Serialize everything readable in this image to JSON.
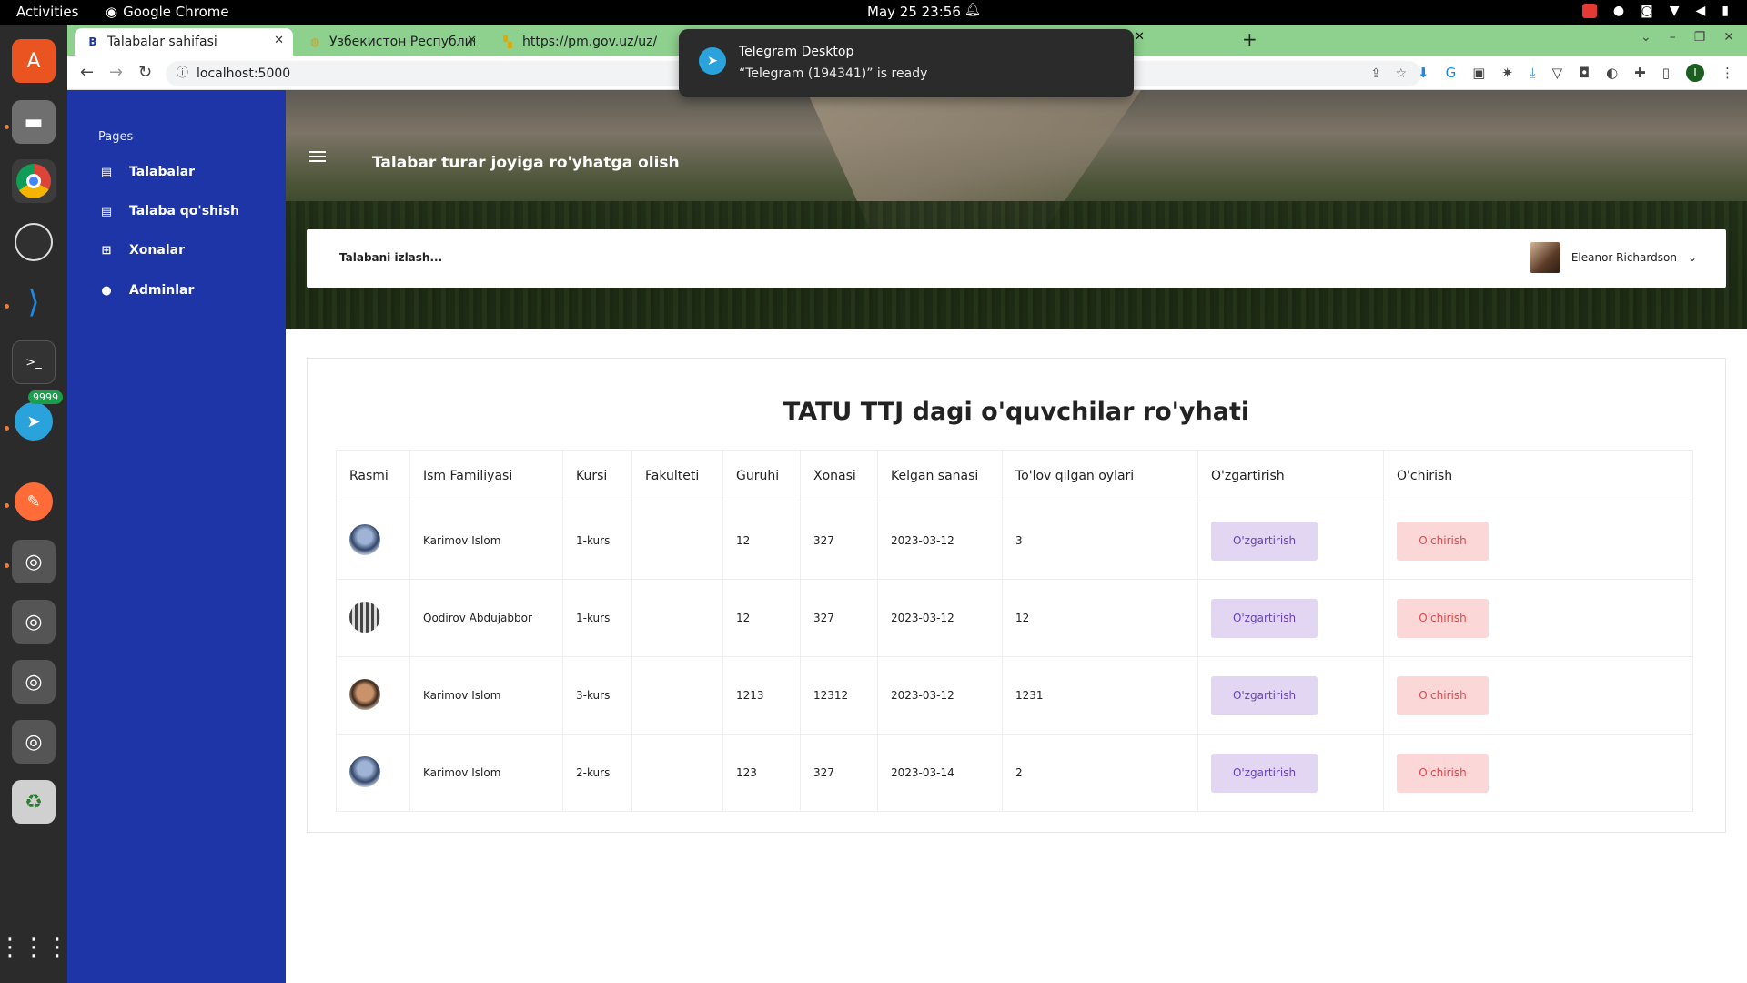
{
  "system": {
    "activities": "Activities",
    "app_name": "Google Chrome",
    "clock": "May 25  23:56"
  },
  "dock": {
    "telegram_badge": "9999",
    "apps": [
      "ubuntu-software",
      "files",
      "chrome",
      "obs",
      "vscode",
      "terminal",
      "telegram",
      "postman",
      "disc-1",
      "disc-2",
      "disc-3",
      "disc-4",
      "trash",
      "show-apps"
    ]
  },
  "browser": {
    "tabs": [
      {
        "label": "Talabalar sahifasi",
        "favicon": "B"
      },
      {
        "label": "Ўзбекистон Республикас",
        "favicon": "globe"
      },
      {
        "label": "https://pm.gov.uz/uz/",
        "favicon": "pm"
      }
    ],
    "url": "localhost:5000"
  },
  "notification": {
    "title": "Telegram Desktop",
    "body": "“Telegram (194341)” is ready"
  },
  "sidebar": {
    "section": "Pages",
    "items": [
      {
        "label": "Talabalar",
        "icon": "list-icon"
      },
      {
        "label": "Talaba qo'shish",
        "icon": "list-icon"
      },
      {
        "label": "Xonalar",
        "icon": "grid-icon"
      },
      {
        "label": "Adminlar",
        "icon": "person-icon"
      }
    ]
  },
  "header": {
    "title": "Talabar turar joyiga ro'yhatga olish",
    "search_placeholder": "Talabani izlash...",
    "user_name": "Eleanor Richardson"
  },
  "content": {
    "heading": "TATU TTJ dagi o'quvchilar ro'yhati",
    "columns": [
      "Rasmi",
      "Ism Familiyasi",
      "Kursi",
      "Fakulteti",
      "Guruhi",
      "Xonasi",
      "Kelgan sanasi",
      "To'lov qilgan oylari",
      "O'zgartirish",
      "O'chirish"
    ],
    "rows": [
      {
        "name": "Karimov Islom",
        "course": "1-kurs",
        "faculty": "",
        "group": "12",
        "room": "327",
        "date": "2023-03-12",
        "paid": "3",
        "edit": "O'zgartirish",
        "delete": "O'chirish"
      },
      {
        "name": "Qodirov Abdujabbor",
        "course": "1-kurs",
        "faculty": "",
        "group": "12",
        "room": "327",
        "date": "2023-03-12",
        "paid": "12",
        "edit": "O'zgartirish",
        "delete": "O'chirish"
      },
      {
        "name": "Karimov Islom",
        "course": "3-kurs",
        "faculty": "",
        "group": "1213",
        "room": "12312",
        "date": "2023-03-12",
        "paid": "1231",
        "edit": "O'zgartirish",
        "delete": "O'chirish"
      },
      {
        "name": "Karimov Islom",
        "course": "2-kurs",
        "faculty": "",
        "group": "123",
        "room": "327",
        "date": "2023-03-14",
        "paid": "2",
        "edit": "O'zgartirish",
        "delete": "O'chirish"
      }
    ]
  }
}
